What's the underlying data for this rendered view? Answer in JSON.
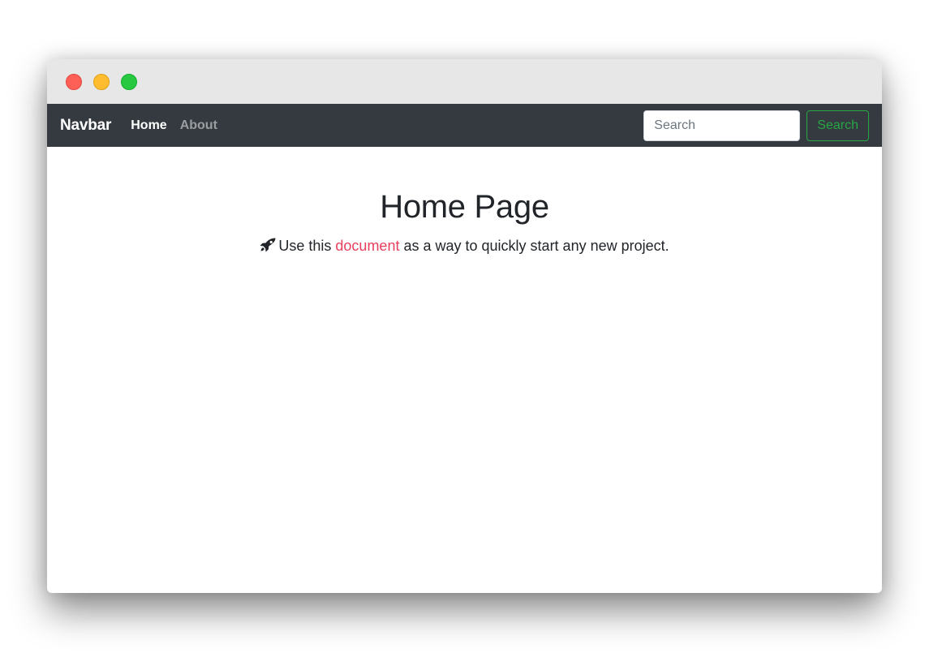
{
  "window": {
    "controls": [
      "close",
      "minimize",
      "zoom"
    ],
    "control_colors": {
      "close": "#fe5f57",
      "minimize": "#febc2e",
      "zoom": "#28c840"
    }
  },
  "navbar": {
    "brand": "Navbar",
    "links": [
      {
        "label": "Home",
        "active": true
      },
      {
        "label": "About",
        "active": false
      }
    ],
    "search": {
      "placeholder": "Search",
      "value": "",
      "button_label": "Search"
    },
    "colors": {
      "background": "#343a40",
      "button_accent": "#28a745"
    }
  },
  "main": {
    "title": "Home Page",
    "lead": {
      "icon": "rocket-icon",
      "before": "Use this",
      "link_text": "document",
      "after": "as a way to quickly start any new project.",
      "link_color": "#e83e5c"
    }
  }
}
